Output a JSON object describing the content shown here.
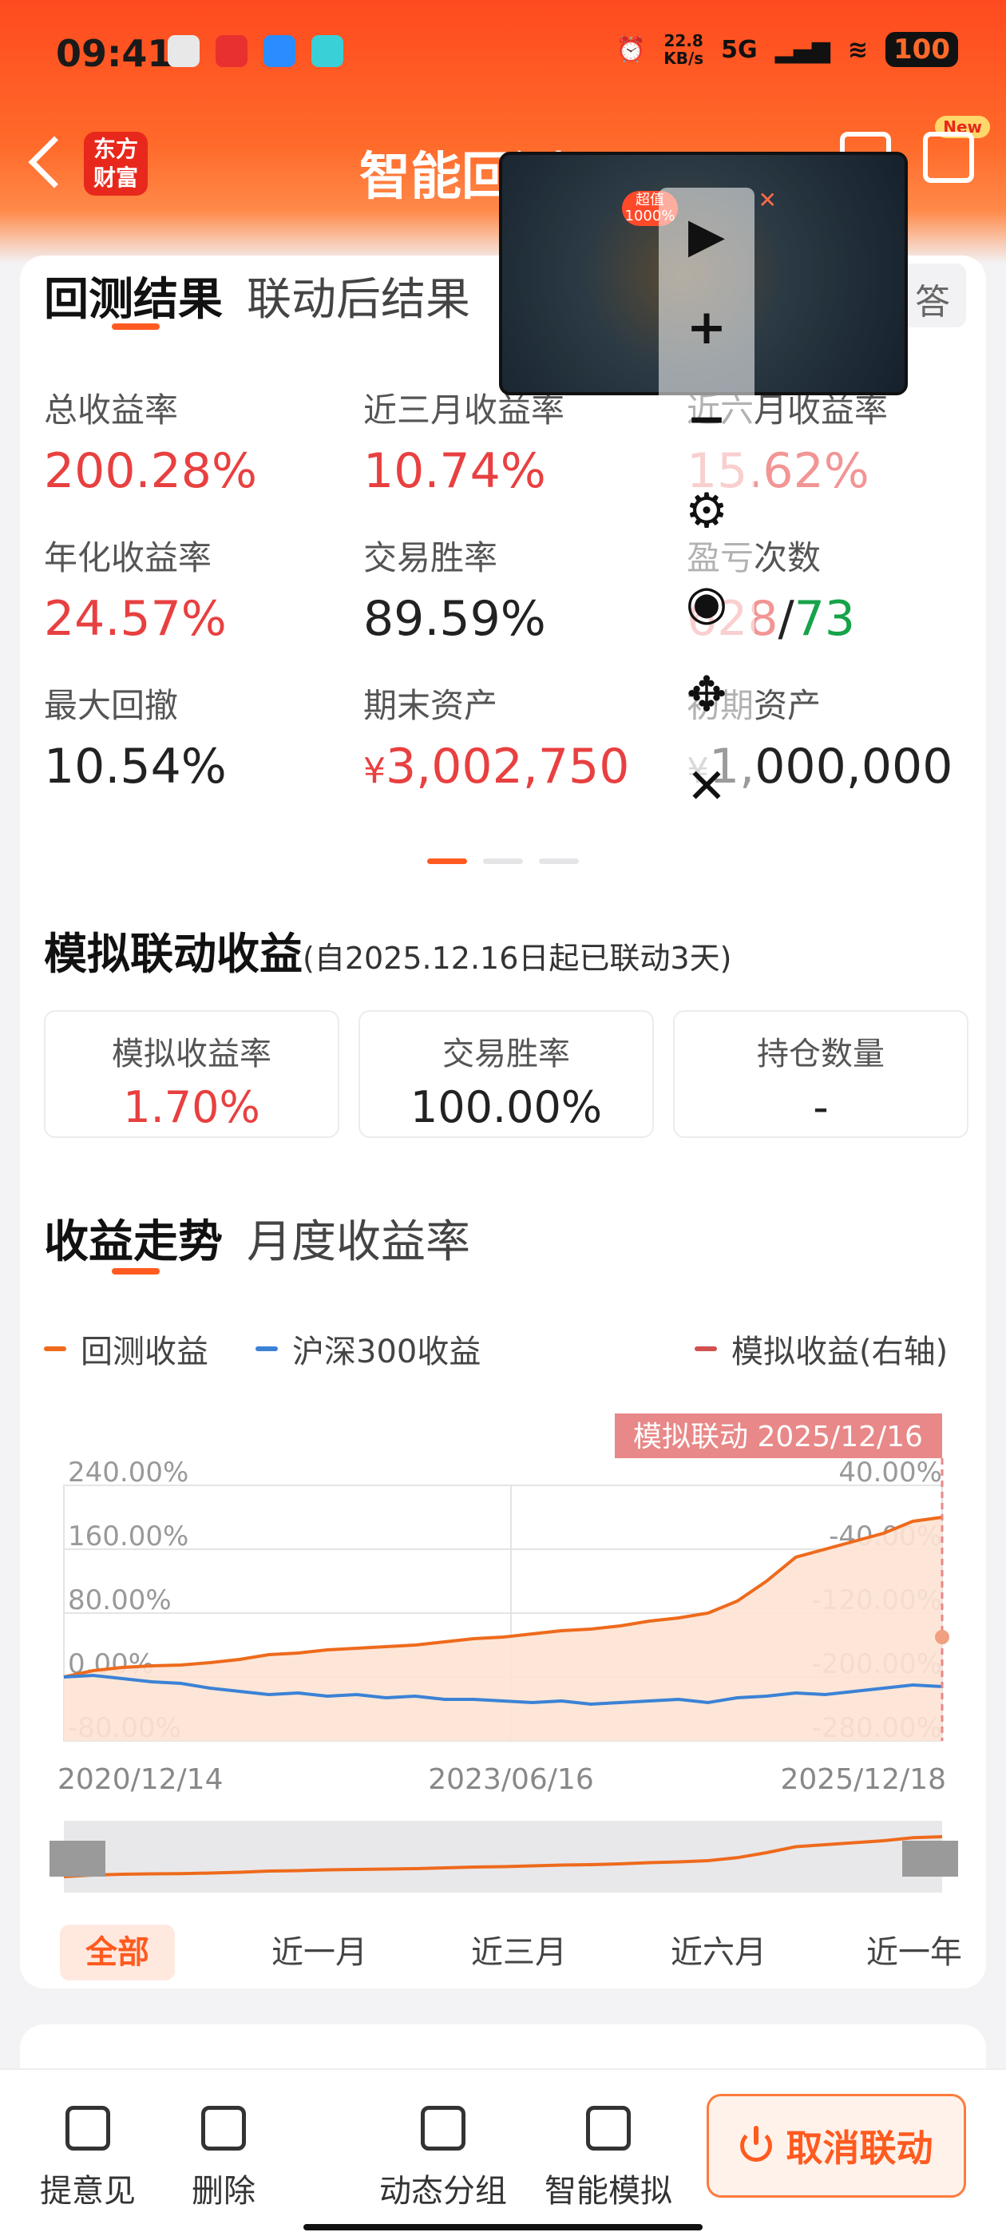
{
  "status_bar": {
    "time": "09:41",
    "net_speed_value": "22.8",
    "net_speed_unit": "KB/s",
    "network": "5G",
    "battery": "100"
  },
  "nav": {
    "title": "智能回测",
    "logo_line1": "东方",
    "logo_line2": "财富",
    "new_badge": "New"
  },
  "result_tabs": {
    "active": "回测结果",
    "inactive": "联动后结果",
    "right_btn": "答"
  },
  "stats": {
    "total_return_label": "总收益率",
    "total_return": "200.28%",
    "three_month_label": "近三月收益率",
    "three_month": "10.74%",
    "six_month_label": "近六月收益率",
    "six_month": "15.62%",
    "annual_label": "年化收益率",
    "annual": "24.57%",
    "win_rate_label": "交易胜率",
    "win_rate": "89.59%",
    "pl_count_label": "盈亏次数",
    "win_count": "628",
    "loss_count": "73",
    "max_drawdown_label": "最大回撤",
    "max_drawdown": "10.54%",
    "end_asset_label": "期末资产",
    "end_asset": "3,002,750",
    "currency": "¥",
    "init_asset_label": "初期资产",
    "init_asset": "1,000,000"
  },
  "simulation": {
    "title": "模拟联动收益",
    "subtitle": "(自2025.12.16日起已联动3天)",
    "return_label": "模拟收益率",
    "return_value": "1.70%",
    "win_label": "交易胜率",
    "win_value": "100.00%",
    "hold_label": "持仓数量",
    "hold_value": "-"
  },
  "chart_tabs": {
    "active": "收益走势",
    "inactive": "月度收益率"
  },
  "colors": {
    "accent": "#ff5a1f",
    "red": "#e84040",
    "blue": "#3b82d6",
    "green": "#16a34a"
  },
  "chart_data": {
    "type": "line",
    "annotation": "模拟联动 2025/12/16",
    "x_ticks": [
      "2020/12/14",
      "2023/06/16",
      "2025/12/18"
    ],
    "y_left_ticks": [
      "240.00%",
      "160.00%",
      "80.00%",
      "0.00%",
      "-80.00%"
    ],
    "y_right_ticks": [
      "40.00%",
      "-40.00%",
      "-120.00%",
      "-200.00%",
      "-280.00%"
    ],
    "ylim_left": [
      -80,
      240
    ],
    "ylim_right": [
      -280,
      40
    ],
    "series": [
      {
        "name": "回测收益",
        "color": "#ee6a1c",
        "axis": "left",
        "values": [
          0,
          8,
          12,
          14,
          15,
          18,
          22,
          28,
          30,
          34,
          36,
          38,
          40,
          44,
          48,
          50,
          54,
          58,
          60,
          64,
          70,
          74,
          80,
          95,
          120,
          150,
          160,
          170,
          180,
          195,
          200
        ]
      },
      {
        "name": "沪深300收益",
        "color": "#3b82d6",
        "axis": "left",
        "values": [
          0,
          2,
          -2,
          -6,
          -8,
          -14,
          -18,
          -22,
          -20,
          -24,
          -22,
          -26,
          -24,
          -28,
          -28,
          -30,
          -32,
          -30,
          -34,
          -32,
          -30,
          -28,
          -32,
          -26,
          -24,
          -20,
          -22,
          -18,
          -14,
          -10,
          -12
        ]
      },
      {
        "name": "模拟收益(右轴)",
        "color": "#d25050",
        "axis": "right",
        "values": []
      }
    ]
  },
  "range_tabs": [
    "全部",
    "近一月",
    "近三月",
    "近六月",
    "近一年"
  ],
  "toolbar": {
    "feedback": "提意见",
    "delete": "删除",
    "group": "动态分组",
    "smart_sim": "智能模拟",
    "cancel": "取消联动"
  },
  "overlay": {
    "badge": "超值1000%"
  }
}
